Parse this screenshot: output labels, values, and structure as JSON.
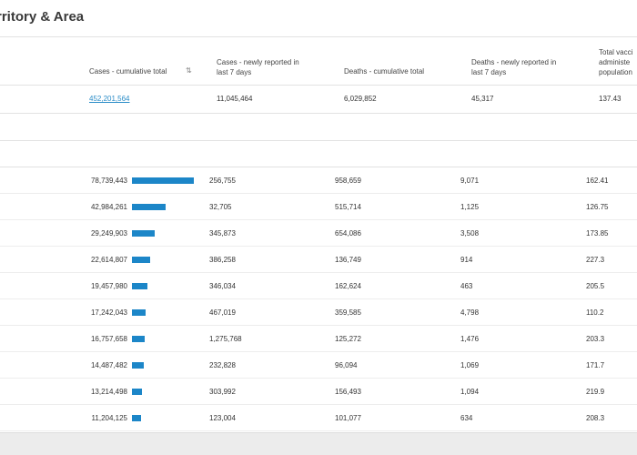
{
  "title": "rritory & Area",
  "colors": {
    "bar": "#1c86c8",
    "link": "#2a8cc7"
  },
  "headers": {
    "cases_total": "Cases - cumulative total",
    "sort_icon": "sort-icon",
    "cases_7d_l1": "Cases - newly reported in",
    "cases_7d_l2": "last 7 days",
    "deaths_total": "Deaths - cumulative total",
    "deaths_7d_l1": "Deaths - newly reported in",
    "deaths_7d_l2": "last 7 days",
    "vacc_l1": "Total vacci",
    "vacc_l2": "administe",
    "vacc_l3": "population"
  },
  "totals": {
    "cases_total": "452,201,564",
    "cases_7d": "11,045,464",
    "deaths_total": "6,029,852",
    "deaths_7d": "45,317",
    "vacc": "137.43"
  },
  "rows": [
    {
      "cases_total": "78,739,443",
      "bar_fraction": 1.0,
      "cases_7d": "256,755",
      "deaths_total": "958,659",
      "deaths_7d": "9,071",
      "vacc": "162.41"
    },
    {
      "cases_total": "42,984,261",
      "bar_fraction": 0.546,
      "cases_7d": "32,705",
      "deaths_total": "515,714",
      "deaths_7d": "1,125",
      "vacc": "126.75"
    },
    {
      "cases_total": "29,249,903",
      "bar_fraction": 0.371,
      "cases_7d": "345,873",
      "deaths_total": "654,086",
      "deaths_7d": "3,508",
      "vacc": "173.85"
    },
    {
      "cases_total": "22,614,807",
      "bar_fraction": 0.287,
      "cases_7d": "386,258",
      "deaths_total": "136,749",
      "deaths_7d": "914",
      "vacc": "227.3"
    },
    {
      "cases_total": "19,457,980",
      "bar_fraction": 0.247,
      "cases_7d": "346,034",
      "deaths_total": "162,624",
      "deaths_7d": "463",
      "vacc": "205.5"
    },
    {
      "cases_total": "17,242,043",
      "bar_fraction": 0.219,
      "cases_7d": "467,019",
      "deaths_total": "359,585",
      "deaths_7d": "4,798",
      "vacc": "110.2"
    },
    {
      "cases_total": "16,757,658",
      "bar_fraction": 0.213,
      "cases_7d": "1,275,768",
      "deaths_total": "125,272",
      "deaths_7d": "1,476",
      "vacc": "203.3"
    },
    {
      "cases_total": "14,487,482",
      "bar_fraction": 0.184,
      "cases_7d": "232,828",
      "deaths_total": "96,094",
      "deaths_7d": "1,069",
      "vacc": "171.7"
    },
    {
      "cases_total": "13,214,498",
      "bar_fraction": 0.168,
      "cases_7d": "303,992",
      "deaths_total": "156,493",
      "deaths_7d": "1,094",
      "vacc": "219.9"
    },
    {
      "cases_total": "11,204,125",
      "bar_fraction": 0.142,
      "cases_7d": "123,004",
      "deaths_total": "101,077",
      "deaths_7d": "634",
      "vacc": "208.3"
    }
  ]
}
